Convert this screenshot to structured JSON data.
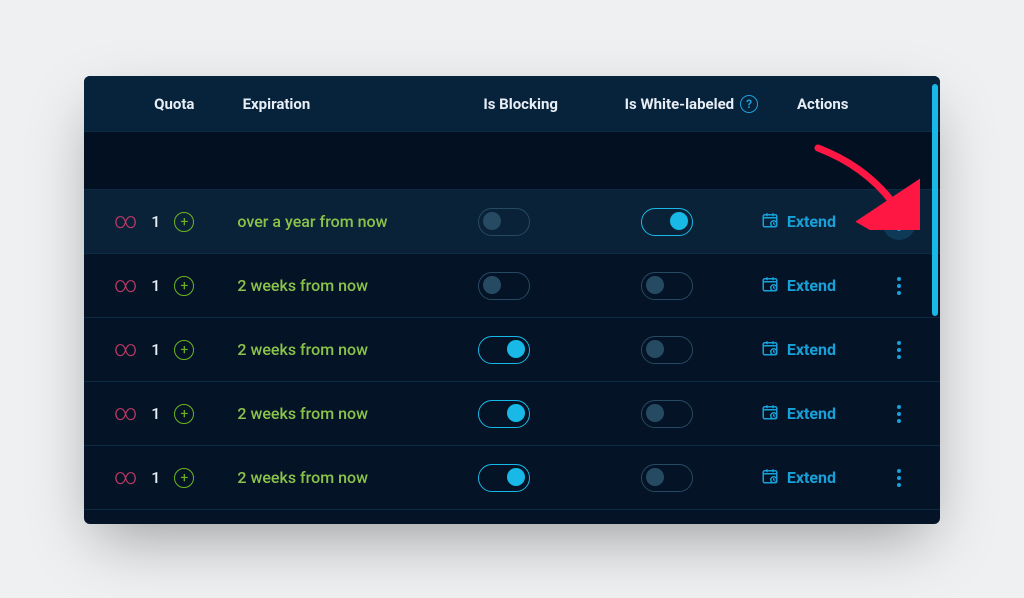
{
  "columns": {
    "quota": "Quota",
    "expiration": "Expiration",
    "blocking": "Is Blocking",
    "white": "Is White-labeled",
    "actions": "Actions"
  },
  "action_label": "Extend",
  "rows": [
    {
      "count": "1",
      "expiration": "over a year from now",
      "blocking": false,
      "white": true,
      "highlight": true,
      "kebab_active": true
    },
    {
      "count": "1",
      "expiration": "2 weeks from now",
      "blocking": false,
      "white": false,
      "highlight": false,
      "kebab_active": false
    },
    {
      "count": "1",
      "expiration": "2 weeks from now",
      "blocking": true,
      "white": false,
      "highlight": false,
      "kebab_active": false
    },
    {
      "count": "1",
      "expiration": "2 weeks from now",
      "blocking": true,
      "white": false,
      "highlight": false,
      "kebab_active": false
    },
    {
      "count": "1",
      "expiration": "2 weeks from now",
      "blocking": true,
      "white": false,
      "highlight": false,
      "kebab_active": false
    }
  ]
}
